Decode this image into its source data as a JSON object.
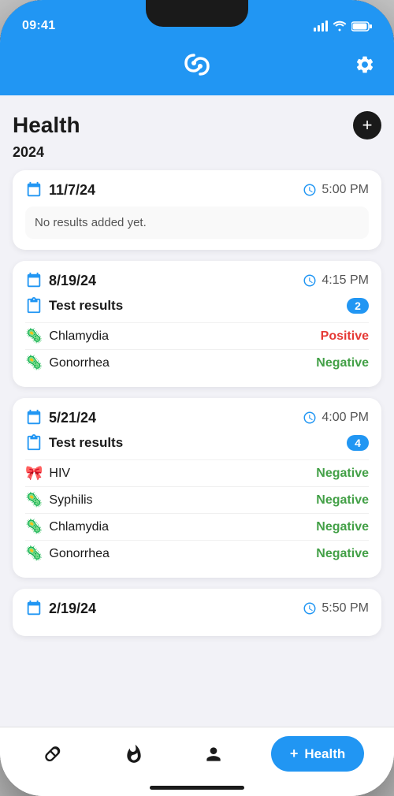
{
  "status": {
    "time": "09:41"
  },
  "header": {
    "settings_label": "settings"
  },
  "page": {
    "title": "Health",
    "add_label": "+",
    "year": "2024"
  },
  "records": [
    {
      "date": "11/7/24",
      "time": "5:00 PM",
      "no_results": "No results added yet.",
      "has_results": false,
      "tests": []
    },
    {
      "date": "8/19/24",
      "time": "4:15 PM",
      "has_results": true,
      "results_label": "Test results",
      "badge": "2",
      "tests": [
        {
          "name": "Chlamydia",
          "result": "Positive",
          "result_type": "positive"
        },
        {
          "name": "Gonorrhea",
          "result": "Negative",
          "result_type": "negative"
        }
      ]
    },
    {
      "date": "5/21/24",
      "time": "4:00 PM",
      "has_results": true,
      "results_label": "Test results",
      "badge": "4",
      "tests": [
        {
          "name": "HIV",
          "result": "Negative",
          "result_type": "negative",
          "icon": "ribbon"
        },
        {
          "name": "Syphilis",
          "result": "Negative",
          "result_type": "negative",
          "icon": "germ"
        },
        {
          "name": "Chlamydia",
          "result": "Negative",
          "result_type": "negative",
          "icon": "germ"
        },
        {
          "name": "Gonorrhea",
          "result": "Negative",
          "result_type": "negative",
          "icon": "germ"
        }
      ]
    },
    {
      "date": "2/19/24",
      "time": "5:50 PM",
      "has_results": false,
      "tests": []
    }
  ],
  "nav": {
    "pill_icon": "💊",
    "flame_icon": "🔥",
    "person_icon": "👤",
    "health_label": "Health",
    "health_plus": "+"
  }
}
